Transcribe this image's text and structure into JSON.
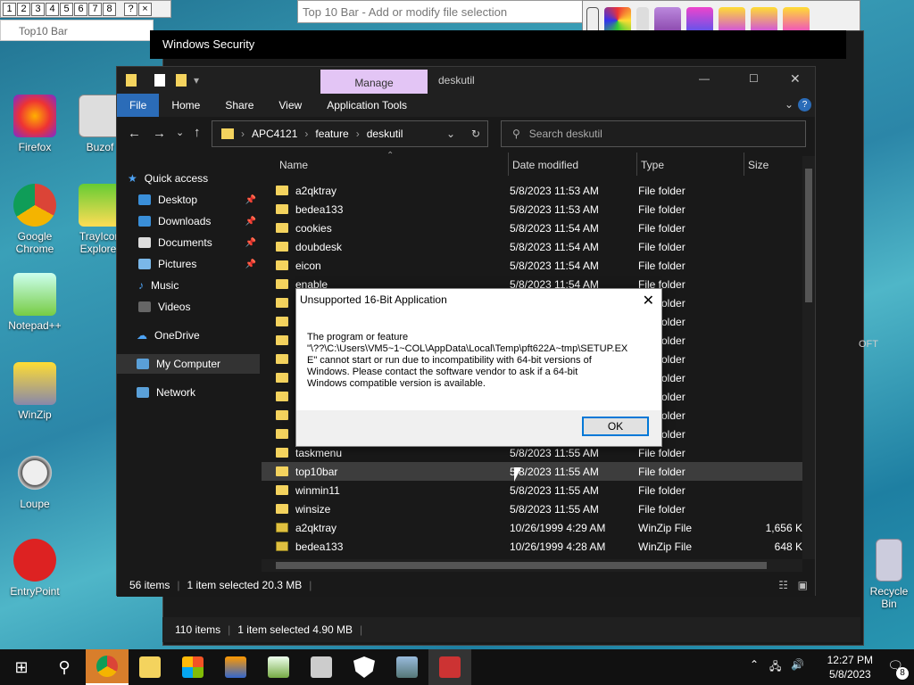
{
  "top10bar": {
    "numbers": [
      "1",
      "2",
      "3",
      "4",
      "5",
      "6",
      "7",
      "8"
    ],
    "help": "?",
    "close": "×",
    "taskbar_title": "Top10 Bar",
    "main_window_title": "Top 10 Bar - Add or modify file selection"
  },
  "windows_security": {
    "title": "Windows Security"
  },
  "behind_window": {
    "status_items": "110 items",
    "status_selected": "1 item selected  4.90 MB",
    "fragment": "OFT"
  },
  "desktop_icons": [
    "Firefox",
    "Buzof",
    "Google Chrome",
    "TrayIcon Explorer",
    "Notepad++",
    "WinZip",
    "Loupe",
    "EntryPoint",
    "Recycle Bin"
  ],
  "explorer": {
    "manage_tab": "Manage",
    "window_title": "deskutil",
    "ribbon_tabs": [
      "File",
      "Home",
      "Share",
      "View",
      "Application Tools"
    ],
    "breadcrumb": [
      "APC4121",
      "feature",
      "deskutil"
    ],
    "search_placeholder": "Search deskutil",
    "nav": {
      "quick_access": "Quick access",
      "desktop": "Desktop",
      "downloads": "Downloads",
      "documents": "Documents",
      "pictures": "Pictures",
      "music": "Music",
      "videos": "Videos",
      "onedrive": "OneDrive",
      "my_computer": "My Computer",
      "network": "Network"
    },
    "columns": {
      "name": "Name",
      "date": "Date modified",
      "type": "Type",
      "size": "Size"
    },
    "rows": [
      {
        "name": "a2qktray",
        "date": "5/8/2023 11:53 AM",
        "type": "File folder",
        "size": ""
      },
      {
        "name": "bedea133",
        "date": "5/8/2023 11:53 AM",
        "type": "File folder",
        "size": ""
      },
      {
        "name": "cookies",
        "date": "5/8/2023 11:54 AM",
        "type": "File folder",
        "size": ""
      },
      {
        "name": "doubdesk",
        "date": "5/8/2023 11:54 AM",
        "type": "File folder",
        "size": ""
      },
      {
        "name": "eicon",
        "date": "5/8/2023 11:54 AM",
        "type": "File folder",
        "size": ""
      },
      {
        "name": "enable",
        "date": "5/8/2023 11:54 AM",
        "type": "File folder",
        "size": ""
      },
      {
        "name": "",
        "date": "",
        "type": "File folder",
        "size": ""
      },
      {
        "name": "",
        "date": "",
        "type": "File folder",
        "size": ""
      },
      {
        "name": "",
        "date": "",
        "type": "File folder",
        "size": ""
      },
      {
        "name": "",
        "date": "",
        "type": "File folder",
        "size": ""
      },
      {
        "name": "",
        "date": "",
        "type": "File folder",
        "size": ""
      },
      {
        "name": "",
        "date": "",
        "type": "File folder",
        "size": ""
      },
      {
        "name": "",
        "date": "",
        "type": "File folder",
        "size": ""
      },
      {
        "name": "",
        "date": "",
        "type": "File folder",
        "size": ""
      },
      {
        "name": "taskmenu",
        "date": "5/8/2023 11:55 AM",
        "type": "File folder",
        "size": ""
      },
      {
        "name": "top10bar",
        "date": "5/8/2023 11:55 AM",
        "type": "File folder",
        "size": ""
      },
      {
        "name": "winmin11",
        "date": "5/8/2023 11:55 AM",
        "type": "File folder",
        "size": ""
      },
      {
        "name": "winsize",
        "date": "5/8/2023 11:55 AM",
        "type": "File folder",
        "size": ""
      },
      {
        "name": "a2qktray",
        "date": "10/26/1999 4:29 AM",
        "type": "WinZip File",
        "size": "1,656 K"
      },
      {
        "name": "bedea133",
        "date": "10/26/1999 4:28 AM",
        "type": "WinZip File",
        "size": "648 K"
      }
    ],
    "status_items": "56 items",
    "status_selected": "1 item selected  20.3 MB"
  },
  "dialog": {
    "title": "Unsupported 16-Bit Application",
    "body_line1": "The program or feature",
    "body_line2": "\"\\??\\C:\\Users\\VM5~1~COL\\AppData\\Local\\Temp\\pft622A~tmp\\SETUP.EX",
    "body_line3": "E\" cannot start or run due to incompatibility with 64-bit versions of",
    "body_line4": "Windows. Please contact the software vendor to ask if a 64-bit",
    "body_line5": "Windows compatible version is available.",
    "ok_label": "OK"
  },
  "taskbar": {
    "time": "12:27 PM",
    "date": "5/8/2023",
    "notif_count": "8"
  },
  "colors": {
    "accent": "#0078d7",
    "manage_tab": "#e3c5f5",
    "folder": "#f4d35e",
    "file_tab": "#2b6cb8"
  }
}
